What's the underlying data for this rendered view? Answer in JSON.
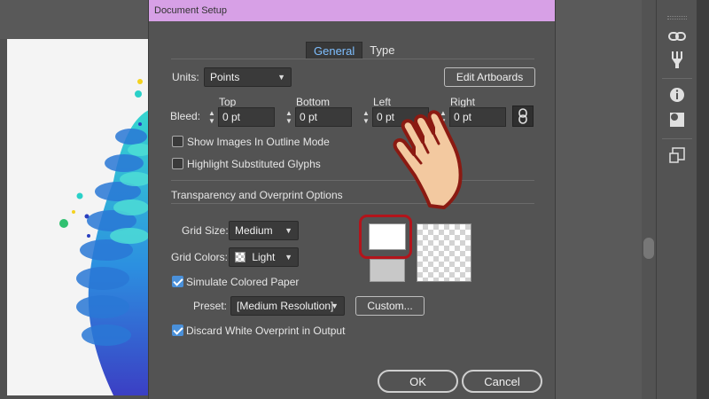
{
  "dialog": {
    "title": "Document Setup",
    "tabs": [
      {
        "label": "General",
        "active": true
      },
      {
        "label": "Type",
        "active": false
      }
    ],
    "units": {
      "label": "Units:",
      "value": "Points"
    },
    "edit_artboards_label": "Edit Artboards",
    "bleed": {
      "label": "Bleed:",
      "fields": [
        {
          "label": "Top",
          "value": "0 pt"
        },
        {
          "label": "Bottom",
          "value": "0 pt"
        },
        {
          "label": "Left",
          "value": "0 pt"
        },
        {
          "label": "Right",
          "value": "0 pt"
        }
      ]
    },
    "show_images_outline": {
      "label": "Show Images In Outline Mode",
      "checked": false
    },
    "highlight_glyphs": {
      "label": "Highlight Substituted Glyphs",
      "checked": false
    },
    "transparency_section_title": "Transparency and Overprint Options",
    "grid_size": {
      "label": "Grid Size:",
      "value": "Medium"
    },
    "grid_colors": {
      "label": "Grid Colors:",
      "value": "Light"
    },
    "simulate_paper": {
      "label": "Simulate Colored Paper",
      "checked": true
    },
    "preset": {
      "label": "Preset:",
      "value": "[Medium Resolution]"
    },
    "custom_label": "Custom...",
    "discard_white": {
      "label": "Discard White Overprint in Output",
      "checked": true
    },
    "ok_label": "OK",
    "cancel_label": "Cancel"
  },
  "colors": {
    "titlebar": "#d7a0e6",
    "dialog_bg": "#535353",
    "active_tab_text": "#7fbfff",
    "highlight_ring": "#b3141b",
    "checkbox_checked": "#4a90d9"
  },
  "icons": {
    "panel": [
      "links-icon",
      "puppet-warp-icon",
      "info-icon",
      "shape-builder-icon",
      "artboard-icon"
    ],
    "bleed_link": "chain-link-icon",
    "pointer": "pointing-hand-icon"
  }
}
